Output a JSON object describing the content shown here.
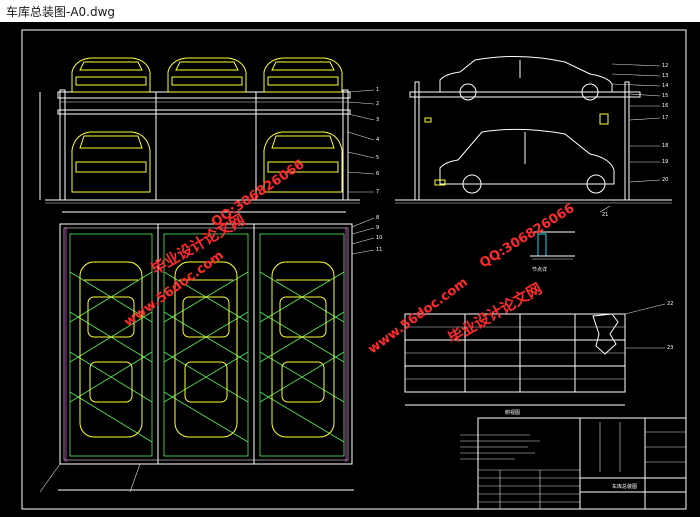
{
  "window": {
    "title": "车库总装图-A0.dwg"
  },
  "drawing": {
    "watermarks": [
      "毕业设计论文网",
      "www.56doc.com",
      "QQ:306826066"
    ],
    "callouts_front": [
      "1",
      "2",
      "3",
      "4",
      "5",
      "6",
      "7"
    ],
    "callouts_top": [
      "8",
      "9",
      "10",
      "11"
    ],
    "callouts_side": [
      "12",
      "13",
      "14",
      "15",
      "16",
      "17",
      "18",
      "19",
      "20",
      "21"
    ],
    "callouts_detail": [
      "22",
      "23"
    ],
    "detail_label": "节点详",
    "detail_caption": "俯视图",
    "title_block_name": "车库总装图"
  }
}
